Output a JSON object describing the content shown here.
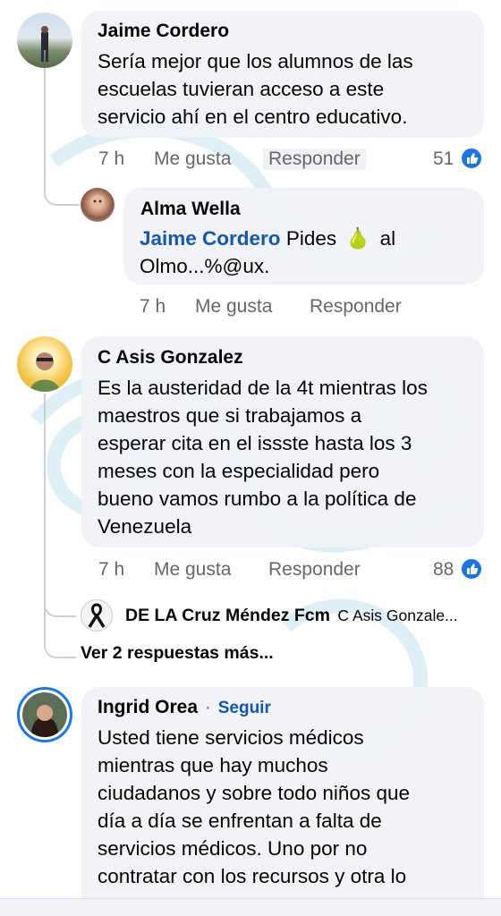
{
  "comments": [
    {
      "author": "Jaime Cordero",
      "lines": [
        "Sería mejor que los alumnos de las",
        "escuelas tuvieran acceso a este",
        "servicio ahí en el centro educativo."
      ],
      "time": "7 h",
      "like": "Me gusta",
      "reply": "Responder",
      "reactions": "51",
      "avatar_icon": "user-photo-landscape"
    },
    {
      "author": "C Asis Gonzalez",
      "lines": [
        "Es la austeridad de la 4t mientras los",
        "maestros que si trabajamos a",
        "esperar cita en el issste hasta los 3",
        "meses con la especialidad pero",
        "bueno vamos rumbo a la política de",
        "Venezuela"
      ],
      "time": "7 h",
      "like": "Me gusta",
      "reply": "Responder",
      "reactions": "88",
      "avatar_icon": "user-photo-yellow"
    },
    {
      "author": "Ingrid Orea",
      "separator": "·",
      "follow": "Seguir",
      "lines": [
        "Usted tiene servicios médicos",
        "mientras que hay muchos",
        "ciudadanos y sobre todo niños que",
        "día a día se enfrentan a falta de",
        "servicios médicos. Uno por no",
        "contratar con los recursos y otra lo"
      ],
      "avatar_icon": "user-photo-woman"
    }
  ],
  "replies": [
    {
      "author": "Alma Wella",
      "mention": "Jaime Cordero",
      "text_before_emoji": "Pides",
      "emoji": "🍐",
      "text_after_emoji": "al",
      "line2": "Olmo...%@ux.",
      "time": "7 h",
      "like": "Me gusta",
      "reply": "Responder",
      "avatar_icon": "user-photo-child"
    }
  ],
  "collapsed_reply": {
    "author": "DE LA Cruz Méndez Fcm",
    "preview": "C Asis Gonzale...",
    "avatar_icon": "mourning-ribbon-icon"
  },
  "more_replies": "Ver 2 respuestas más...",
  "colors": {
    "bubble": "#f0f2f5",
    "meta": "#65676b",
    "link": "#1257b5",
    "like": "#1b74e4"
  }
}
